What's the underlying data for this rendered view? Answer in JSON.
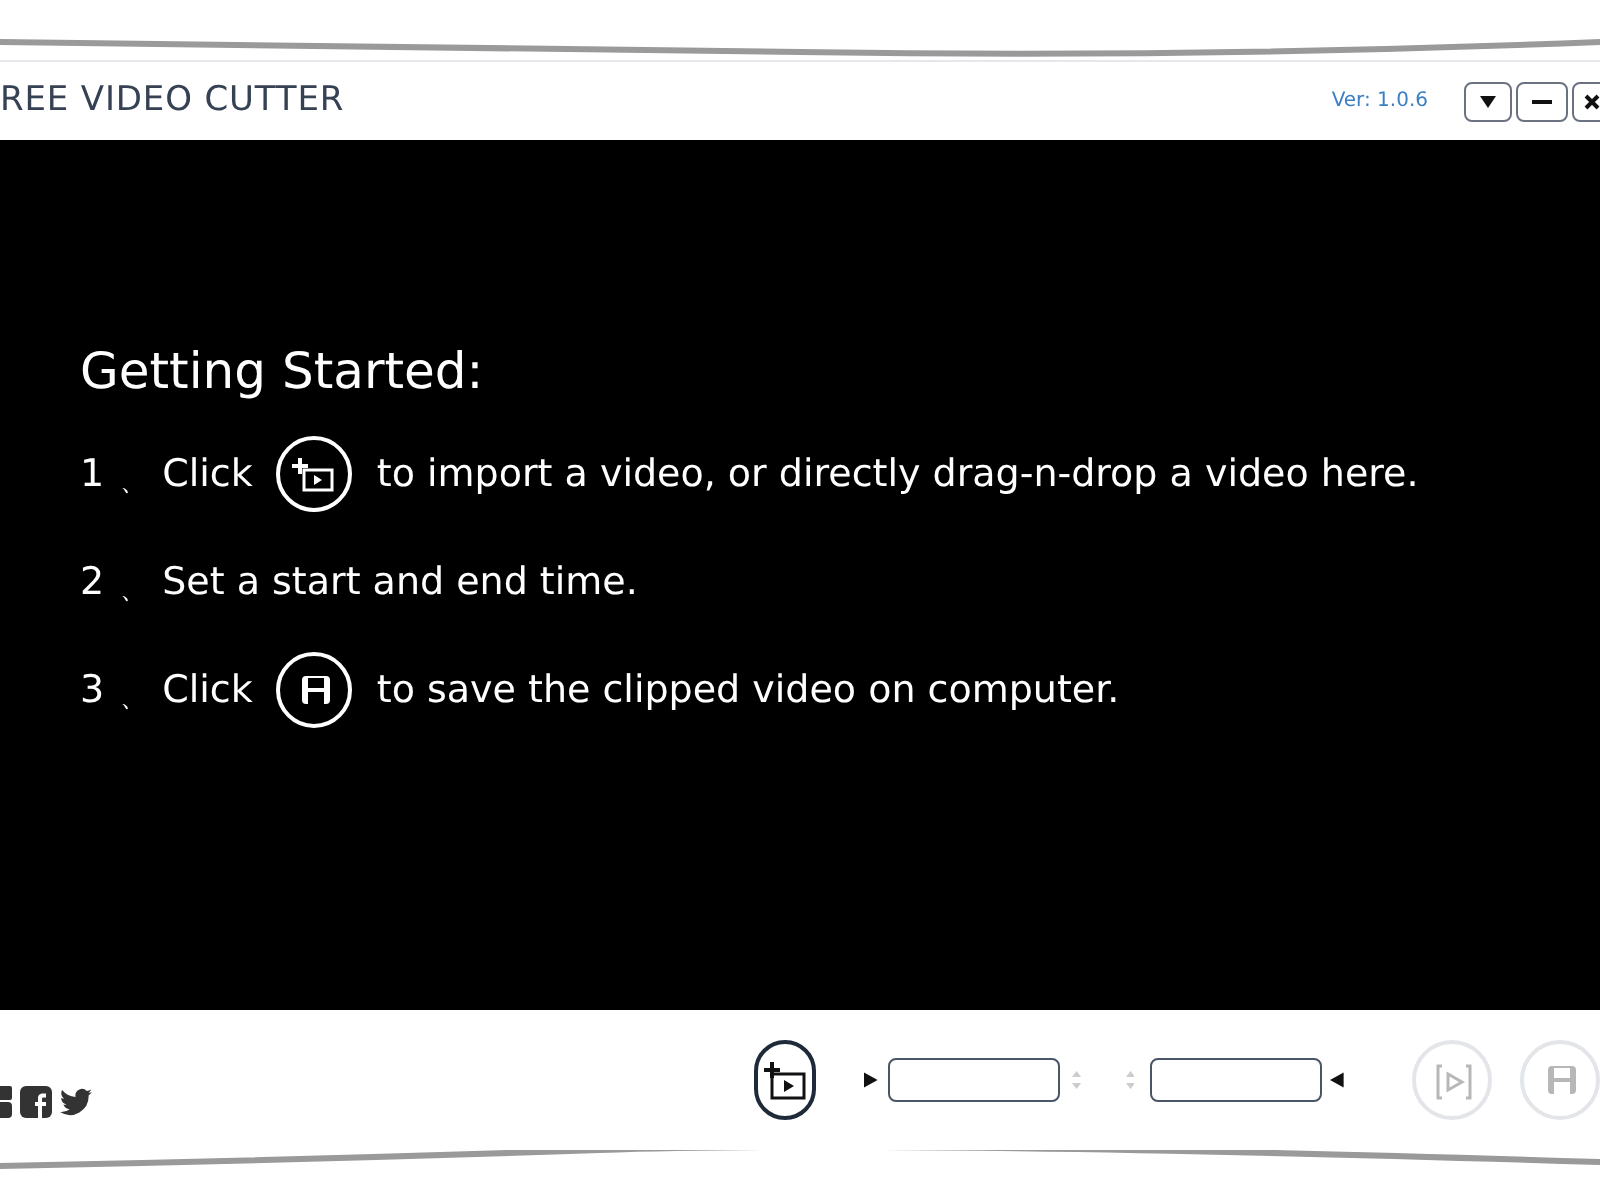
{
  "window": {
    "title": "REE VIDEO CUTTER",
    "version": "Ver: 1.0.6"
  },
  "guide": {
    "heading": "Getting Started:",
    "steps": [
      {
        "number": "1",
        "separator": "、",
        "before": "Click",
        "kind": "import",
        "after": "to import a video, or directly drag-n-drop a video here."
      },
      {
        "number": "2",
        "separator": "、",
        "before": "Set a start and end time."
      },
      {
        "number": "3",
        "separator": "、",
        "before": "Click",
        "kind": "save",
        "after": "to save the clipped video on computer."
      }
    ]
  },
  "toolbar": {
    "actions": [
      {
        "kind": "preview",
        "disabled": true
      },
      {
        "kind": "save",
        "disabled": true
      }
    ]
  }
}
